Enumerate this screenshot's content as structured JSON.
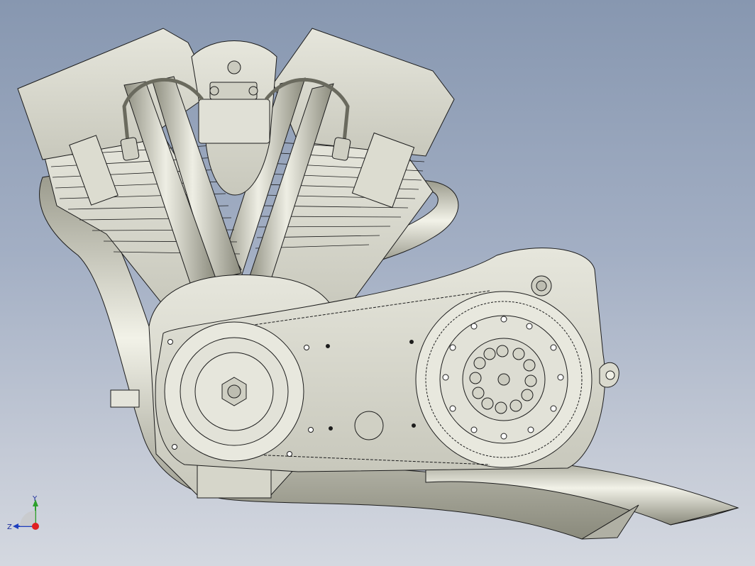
{
  "viewport": {
    "background_top": "#8797b0",
    "background_bottom": "#d4d8e0",
    "model_color": "#d8d8cc",
    "edge_color": "#1c1c1c"
  },
  "triad": {
    "y_label": "Y",
    "z_label": "Z",
    "y_color": "#2ca02c",
    "z_color": "#1f3fbf",
    "x_color": "#e02020"
  }
}
